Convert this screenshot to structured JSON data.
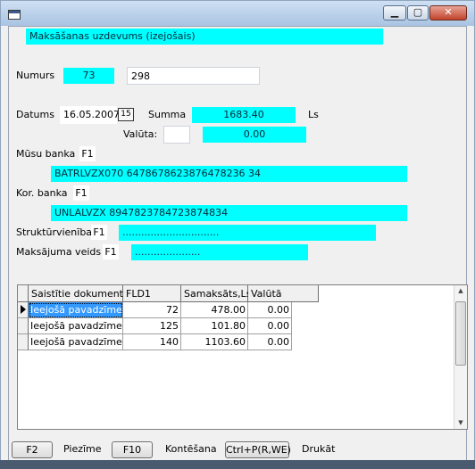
{
  "window": {
    "minimize_icon": "minimize-icon",
    "maximize_icon": "maximize-icon",
    "close_icon": "close-icon"
  },
  "form": {
    "header": "Maksāšanas uzdevums (izejošais)",
    "numurs_label": "Numurs",
    "numurs_value": "73",
    "numurs_extra": "298",
    "datums_label": "Datums",
    "datums_value": "16.05.2007",
    "summa_label": "Summa",
    "summa_value": "1683.40",
    "summa_currency": "Ls",
    "valuta_label": "Valūta:",
    "valuta_code": "",
    "valuta_value": "0.00",
    "musu_banka_label": "Mūsu banka",
    "musu_banka_key": "F1",
    "musu_banka_value": "BATRLVZX070  6478678623876478236 34",
    "kor_banka_label": "Kor. banka",
    "kor_banka_key": "F1",
    "kor_banka_value": "UNLALVZX     8947823784723874834",
    "strukturvieniba_label": "Struktūrvienība",
    "strukturvieniba_key": "F1",
    "strukturvieniba_value": "...............................",
    "maksajuma_veids_label": "Maksājuma veids",
    "maksajuma_veids_key": "F1",
    "maksajuma_veids_value": "....................."
  },
  "grid": {
    "columns": [
      "Saistītie dokumenti",
      "FLD1",
      "Samaksāts,Ls",
      "Valūtā"
    ],
    "rows": [
      [
        "Ieejošā pavadzīme",
        "72",
        "478.00",
        "0.00"
      ],
      [
        "Ieejošā pavadzīme",
        "125",
        "101.80",
        "0.00"
      ],
      [
        "Ieejošā pavadzīme",
        "140",
        "1103.60",
        "0.00"
      ]
    ]
  },
  "footer": {
    "f2_button": "F2",
    "f2_label": "Piezīme",
    "f10_button": "F10",
    "f10_label": "Kontēšana",
    "print_button": "Ctrl+P(R,WE)",
    "print_label": "Drukāt"
  }
}
